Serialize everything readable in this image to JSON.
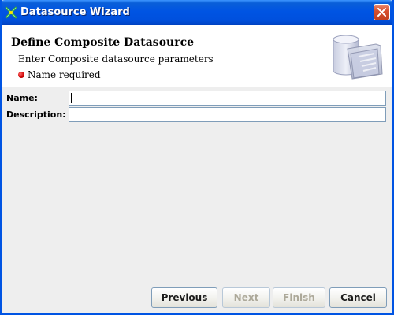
{
  "window": {
    "title": "Datasource Wizard",
    "app_icon": "wizard-icon",
    "close_icon": "close-icon"
  },
  "header": {
    "title": "Define Composite Datasource",
    "subtitle": "Enter Composite datasource parameters",
    "message": "Name required",
    "message_icon": "error-dot-icon",
    "graphic": "database-icon"
  },
  "form": {
    "name_label": "Name:",
    "name_value": "",
    "description_label": "Description:",
    "description_value": ""
  },
  "buttons": {
    "previous": "Previous",
    "next": "Next",
    "finish": "Finish",
    "cancel": "Cancel"
  },
  "colors": {
    "titlebar": "#0054e3",
    "close": "#d8502e",
    "error_dot": "#cc0000"
  }
}
